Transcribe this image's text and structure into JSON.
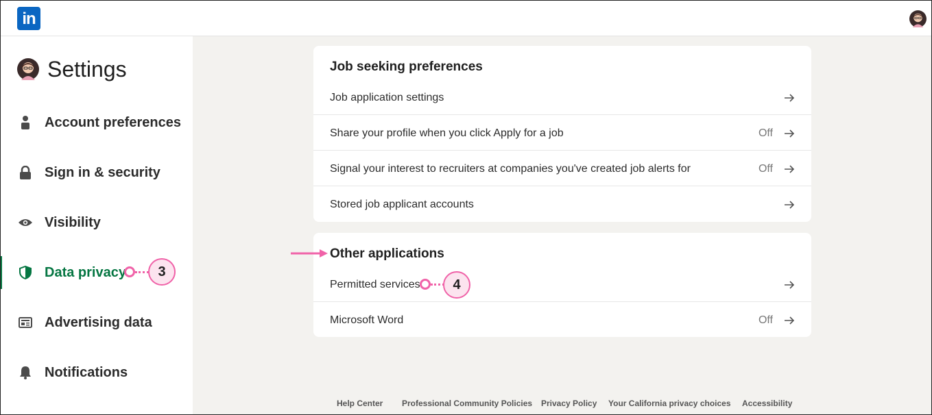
{
  "nav": {
    "logo_text": "in",
    "logo_color": "#0a66c2"
  },
  "sidebar": {
    "title": "Settings",
    "items": [
      {
        "label": "Account preferences",
        "icon": "person-icon"
      },
      {
        "label": "Sign in & security",
        "icon": "lock-icon"
      },
      {
        "label": "Visibility",
        "icon": "eye-icon"
      },
      {
        "label": "Data privacy",
        "icon": "shield-icon",
        "active": true
      },
      {
        "label": "Advertising data",
        "icon": "newspaper-icon"
      },
      {
        "label": "Notifications",
        "icon": "bell-icon"
      }
    ],
    "active_color": "#057642"
  },
  "job_seeking": {
    "title": "Job seeking preferences",
    "rows": [
      {
        "label": "Job application settings",
        "status": ""
      },
      {
        "label": "Share your profile when you click Apply for a job",
        "status": "Off"
      },
      {
        "label": "Signal your interest to recruiters at companies you've created job alerts for",
        "status": "Off"
      },
      {
        "label": "Stored job applicant accounts",
        "status": ""
      }
    ]
  },
  "other_apps": {
    "title": "Other applications",
    "rows": [
      {
        "label": "Permitted services",
        "status": ""
      },
      {
        "label": "Microsoft Word",
        "status": "Off"
      }
    ]
  },
  "footer": {
    "links": [
      "Help Center",
      "Professional Community Policies",
      "Privacy Policy",
      "Your California privacy choices",
      "Accessibility"
    ]
  },
  "callouts": {
    "step3": "3",
    "step4": "4",
    "accent": "#f062a8"
  }
}
